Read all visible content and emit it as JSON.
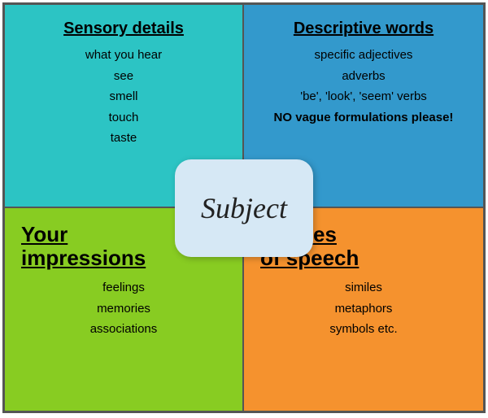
{
  "quadrants": {
    "top_left": {
      "title": "Sensory details",
      "items": [
        "what you hear",
        "see",
        "smell",
        "touch",
        "taste"
      ]
    },
    "top_right": {
      "title": "Descriptive words",
      "items": [
        "specific adjectives",
        "adverbs",
        "'be', 'look', 'seem' verbs",
        "NO  vague formulations please!"
      ]
    },
    "bottom_left": {
      "title": "Your\nimpressions",
      "items": [
        "feelings",
        "memories",
        "associations"
      ]
    },
    "bottom_right": {
      "title": "Figures\nof speech",
      "items": [
        "similes",
        "metaphors",
        "symbols etc."
      ]
    }
  },
  "center": {
    "label": "Subject"
  }
}
